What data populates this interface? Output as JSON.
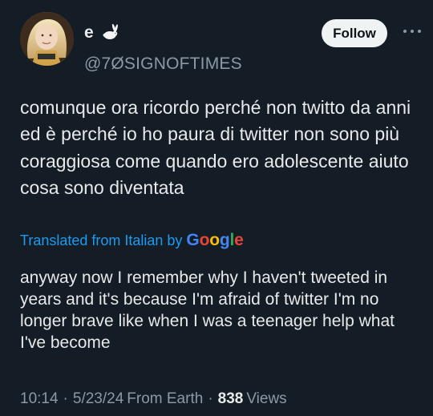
{
  "colors": {
    "background": "#141d26",
    "text_primary": "#e7e9ea",
    "text_secondary": "#8b98a5",
    "link": "#1d9bf0",
    "follow_bg": "#eff3f4",
    "follow_text": "#0f1419"
  },
  "user": {
    "display_name": "e",
    "emoji_icon": "rabbit-icon",
    "handle": "@7ØSIGNOFTIMES"
  },
  "actions": {
    "follow_label": "Follow",
    "more_icon": "more-icon"
  },
  "tweet": {
    "original_text": "comunque ora ricordo perché non twitto da anni ed è perché io ho paura di twitter non sono più coraggiosa come quando ero adolescente aiuto cosa sono diventata",
    "translated_label": "Translated from Italian by",
    "translated_provider": "Google",
    "translated_text": "anyway now I remember why I haven't tweeted in years and it's because I'm afraid of twitter I'm no longer brave like when I was a teenager help what I've become"
  },
  "meta": {
    "time": "10:14",
    "date": "5/23/24",
    "source": "From Earth",
    "views_count": "838",
    "views_label": "Views"
  }
}
